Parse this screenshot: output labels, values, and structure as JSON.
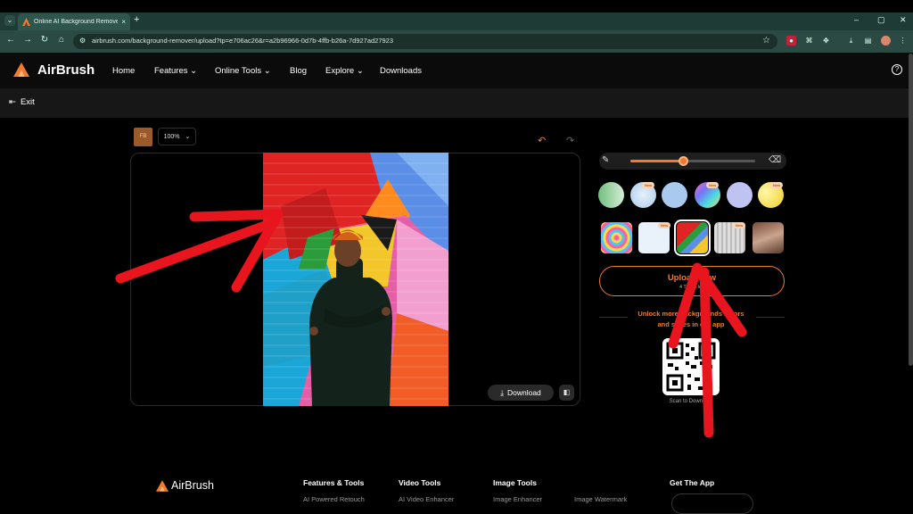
{
  "browser": {
    "tab_title": "Online AI Background Remover",
    "tab_close": "×",
    "new_tab": "+",
    "url": "airbrush.com/background-remover/upload?tp=e706ac26&r=a2b96966-0d7b-4ffb-b26a-7d927ad27923",
    "window_controls": [
      "–",
      "▢",
      "✕"
    ]
  },
  "site": {
    "logo": "AirBrush",
    "nav": [
      "Home",
      "Features",
      "Online Tools",
      "Blog",
      "Explore",
      "Downloads"
    ],
    "exit": "Exit",
    "help": "?"
  },
  "editor": {
    "avatar_text": "FB",
    "zoom": "100%",
    "download": "Download",
    "brush_level": 0.43
  },
  "panel": {
    "new_badge": "New",
    "upload_label": "Upload New",
    "upload_sub": "4 Times left",
    "unlock_line1": "Unlock more backgrounds colors",
    "unlock_line2": "and styles in our app",
    "qr_caption": "Scan to Download",
    "color_swatches": [
      "#a8d8b0",
      "#cfe6f6",
      "#b9d4f2",
      "gradient-rainbow",
      "#c7c9f4",
      "#f6e96a"
    ]
  },
  "footer": {
    "logo": "AirBrush",
    "columns": [
      {
        "heading": "Features & Tools",
        "link": "AI Powered Retouch"
      },
      {
        "heading": "Video Tools",
        "link": "AI Video Enhancer"
      },
      {
        "heading": "Image Tools",
        "link": "Image Enhancer"
      },
      {
        "heading": "",
        "link": "Image Watermark"
      },
      {
        "heading": "Get The App",
        "link": ""
      }
    ]
  },
  "colors": {
    "accent": "#f07b2e",
    "chrome": "#2a4a43",
    "annotation": "#e8141e"
  }
}
